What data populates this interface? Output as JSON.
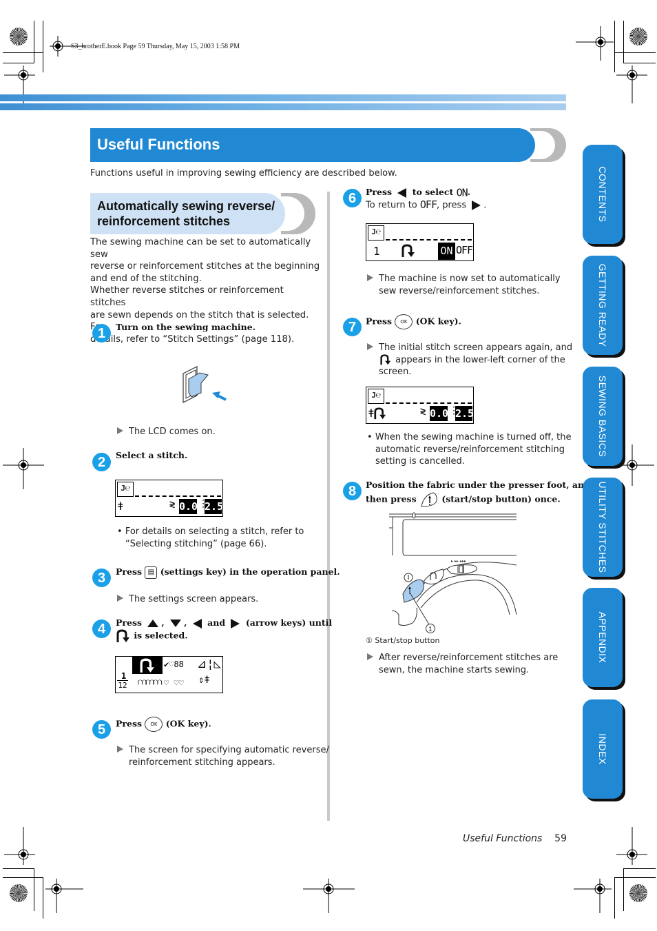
{
  "print_header": "S3_brotherE.book  Page 59  Thursday, May 15, 2003  1:58 PM",
  "page_title": "Useful Functions",
  "intro": "Functions useful in improving sewing efficiency are described below.",
  "section": {
    "title_line1": "Automatically sewing reverse/",
    "title_line2": "reinforcement stitches",
    "para_lines": [
      "The sewing machine can be set to automatically sew",
      "reverse or reinforcement stitches at the beginning",
      "and end of the stitching.",
      "Whether reverse stitches or reinforcement stitches",
      "are sewn depends on the stitch that is selected. For",
      "details, refer to “Stitch Settings” (page 118)."
    ]
  },
  "steps": {
    "s1": {
      "num": "1",
      "title": "Turn on the sewing machine.",
      "result": "The LCD comes on."
    },
    "s2": {
      "num": "2",
      "title": "Select a stitch.",
      "bullet1": "For details on selecting a stitch, refer to",
      "bullet2": "“Selecting stitching” (page 66)."
    },
    "s3": {
      "num": "3",
      "press": "Press",
      "key_glyph": "▤",
      "title_rest": "(settings key) in the operation panel.",
      "result": "The settings screen appears."
    },
    "s4": {
      "num": "4",
      "press": "Press",
      "sep1": ",",
      "sep2": ",",
      "and": "and",
      "rest": "(arrow keys) until",
      "line2": "is selected."
    },
    "s5": {
      "num": "5",
      "press": "Press",
      "ok_label": "OK",
      "rest": "(OK key).",
      "result1": "The screen for specifying automatic reverse/",
      "result2": "reinforcement stitching appears."
    },
    "s6": {
      "num": "6",
      "press": "Press",
      "to_select": "to select",
      "on": "ON",
      "line2_a": "To return to",
      "off": "OFF",
      "line2_b": ", press",
      "result1": "The machine is now set to automatically",
      "result2": "sew reverse/reinforcement stitches."
    },
    "s7": {
      "num": "7",
      "press": "Press",
      "ok_label": "OK",
      "rest": "(OK key).",
      "result1": "The initial stitch screen appears again, and",
      "result2": "appears in the lower-left corner of the",
      "result3": "screen.",
      "bullet1": "When the sewing machine is turned off, the",
      "bullet2": "automatic reverse/reinforcement stitching",
      "bullet3": "setting is cancelled."
    },
    "s8": {
      "num": "8",
      "title1": "Position the fabric under the presser foot, and",
      "title2a": "then press",
      "title2b": "(start/stop button) once.",
      "callout": "①",
      "caption": "Start/stop button",
      "result1": "After reverse/reinforcement stitches are",
      "result2": "sewn, the machine starts sewing."
    }
  },
  "lcd": {
    "stitch_icon": "J℮",
    "width_value": "0.0",
    "length_value": "2.5",
    "settings": {
      "page_top": "1",
      "page_bottom": "12",
      "row1_mid": "✔♡88",
      "row2_mid": "♡ ♡♡"
    },
    "reverse": {
      "page": "1",
      "on": "ON",
      "off": "OFF"
    }
  },
  "tabs": [
    "CONTENTS",
    "GETTING READY",
    "SEWING BASICS",
    "UTILITY STITCHES",
    "APPENDIX",
    "INDEX"
  ],
  "footer": {
    "section": "Useful Functions",
    "page": "59"
  },
  "colors": {
    "brand_blue": "#2189d4",
    "badge_blue": "#1aa0e6",
    "section_bg": "#cfe2f5",
    "illustration_blue": "#a9cdef"
  }
}
